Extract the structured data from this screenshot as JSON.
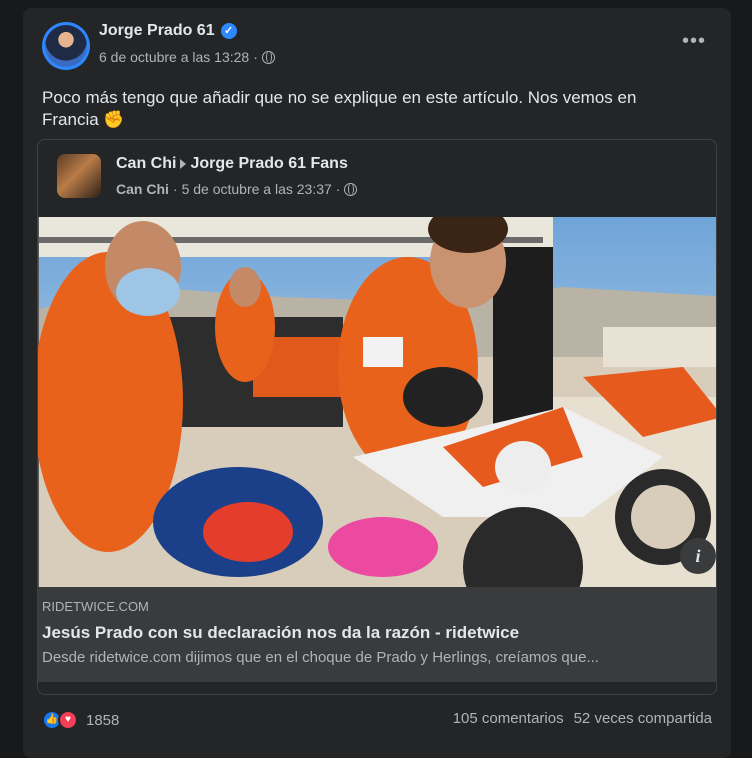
{
  "post": {
    "author": "Jorge Prado 61",
    "timestamp": "6 de octubre a las 13:28",
    "text": "Poco más tengo que añadir que no se explique en este artículo. Nos vemos en Francia ✊",
    "more_icon": "more-horizontal-icon",
    "verified_icon": "verified-badge-icon"
  },
  "shared": {
    "author": "Can Chi",
    "target": "Jorge Prado 61 Fans",
    "meta_author": "Can Chi",
    "timestamp": "5 de octubre a las 23:37",
    "link": {
      "domain": "RIDETWICE.COM",
      "title": "Jesús Prado con su declaración nos da la razón - ridetwice",
      "description": "Desde ridetwice.com dijimos que en el choque de Prado y Herlings, creíamos que..."
    }
  },
  "footer": {
    "reaction_count": "1858",
    "comments": "105 comentarios",
    "shares": "52 veces compartida"
  },
  "colors": {
    "background": "#18191a",
    "card": "#242526",
    "accent": "#2d88ff",
    "like": "#1877f2",
    "love": "#f33e58"
  }
}
